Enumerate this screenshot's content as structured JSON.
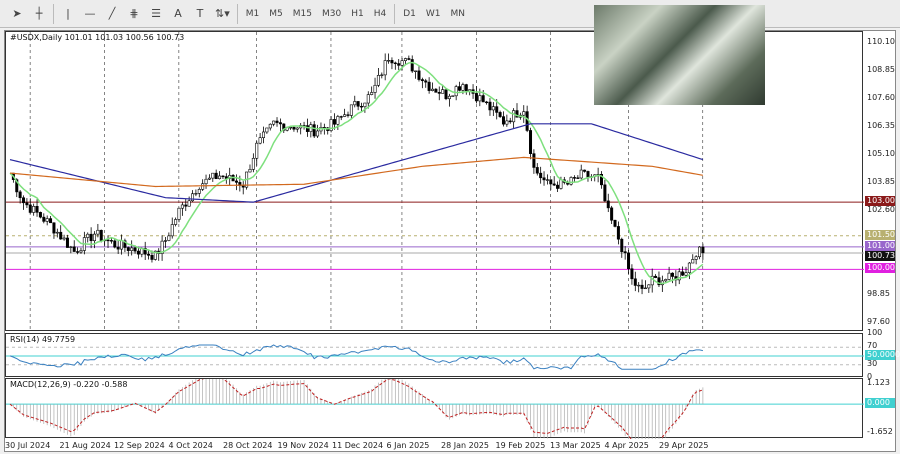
{
  "toolbar": {
    "timeframes": [
      "M1",
      "M5",
      "M15",
      "M30",
      "H1",
      "H4",
      "D1",
      "W1",
      "MN"
    ],
    "tools": [
      "cursor-icon",
      "crosshair-icon",
      "vertical-line-icon",
      "horizontal-line-icon",
      "trendline-icon",
      "fibonacci-icon",
      "fibo-grid-icon",
      "text-icon",
      "text-label-icon",
      "arrows-icon"
    ],
    "text_label": "A",
    "label_label": "T"
  },
  "chart": {
    "title": "#USDX,Daily  101.01 101.03 100.56 100.73",
    "price_ticks": [
      "110.10",
      "108.85",
      "107.60",
      "106.35",
      "105.10",
      "103.85",
      "102.60",
      "98.85",
      "97.60"
    ],
    "levels": [
      {
        "label": "103.00",
        "value": 103.0,
        "color": "#8b1a1a",
        "style": "solid"
      },
      {
        "label": "101.50",
        "value": 101.5,
        "color": "#b8b070",
        "style": "dashed"
      },
      {
        "label": "101.00",
        "value": 101.0,
        "color": "#9966cc",
        "style": "solid"
      },
      {
        "label": "100.73",
        "value": 100.73,
        "color": "#111111",
        "style": "solid"
      },
      {
        "label": "100.00",
        "value": 100.0,
        "color": "#e020e0",
        "style": "solid"
      }
    ],
    "dates": [
      "30 Jul 2024",
      "21 Aug 2024",
      "12 Sep 2024",
      "4 Oct 2024",
      "28 Oct 2024",
      "19 Nov 2024",
      "11 Dec 2024",
      "6 Jan 2025",
      "28 Jan 2025",
      "19 Feb 2025",
      "13 Mar 2025",
      "4 Apr 2025",
      "29 Apr 2025"
    ]
  },
  "rsi": {
    "title": "RSI(14) 49.7759",
    "ticks": [
      "100",
      "70",
      "30",
      "0"
    ],
    "level_tag": "50.0000"
  },
  "macd": {
    "title": "MACD(12,26,9) -0.220 -0.588",
    "ticks": [
      "1.123",
      "-1.652"
    ],
    "level_tag": "0.000"
  },
  "chart_data": {
    "type": "candlestick",
    "ylim": [
      97.2,
      110.6
    ],
    "close_keypoints": [
      [
        0,
        104.3
      ],
      [
        4,
        103
      ],
      [
        12,
        102
      ],
      [
        19,
        100.8
      ],
      [
        25,
        101.6
      ],
      [
        31,
        101.1
      ],
      [
        37,
        100.9
      ],
      [
        43,
        100.6
      ],
      [
        46,
        101.3
      ],
      [
        50,
        102.6
      ],
      [
        56,
        103.8
      ],
      [
        62,
        104.2
      ],
      [
        69,
        103.8
      ],
      [
        73,
        105.5
      ],
      [
        78,
        106.5
      ],
      [
        84,
        106.4
      ],
      [
        90,
        106.2
      ],
      [
        96,
        106.5
      ],
      [
        101,
        107.2
      ],
      [
        107,
        107.8
      ],
      [
        112,
        109.5
      ],
      [
        118,
        109.2
      ],
      [
        124,
        108.2
      ],
      [
        129,
        107.8
      ],
      [
        134,
        108.3
      ],
      [
        140,
        107.5
      ],
      [
        146,
        106.6
      ],
      [
        152,
        107.2
      ],
      [
        155,
        104.5
      ],
      [
        159,
        103.8
      ],
      [
        165,
        103.8
      ],
      [
        169,
        104.2
      ],
      [
        174,
        104.1
      ],
      [
        177,
        102.5
      ],
      [
        181,
        101
      ],
      [
        184,
        99.5
      ],
      [
        187,
        99
      ],
      [
        190,
        99.5
      ],
      [
        196,
        99.6
      ],
      [
        200,
        100
      ],
      [
        203,
        100.8
      ],
      [
        205,
        100.73
      ]
    ],
    "ma100_keypoints": [
      [
        0,
        104.9
      ],
      [
        46,
        103.2
      ],
      [
        72,
        103.0
      ],
      [
        154,
        106.5
      ],
      [
        172,
        106.5
      ],
      [
        205,
        104.9
      ]
    ],
    "ma200_keypoints": [
      [
        0,
        104.3
      ],
      [
        43,
        103.7
      ],
      [
        87,
        103.8
      ],
      [
        122,
        104.6
      ],
      [
        152,
        105
      ],
      [
        190,
        104.6
      ],
      [
        205,
        104.2
      ]
    ]
  }
}
